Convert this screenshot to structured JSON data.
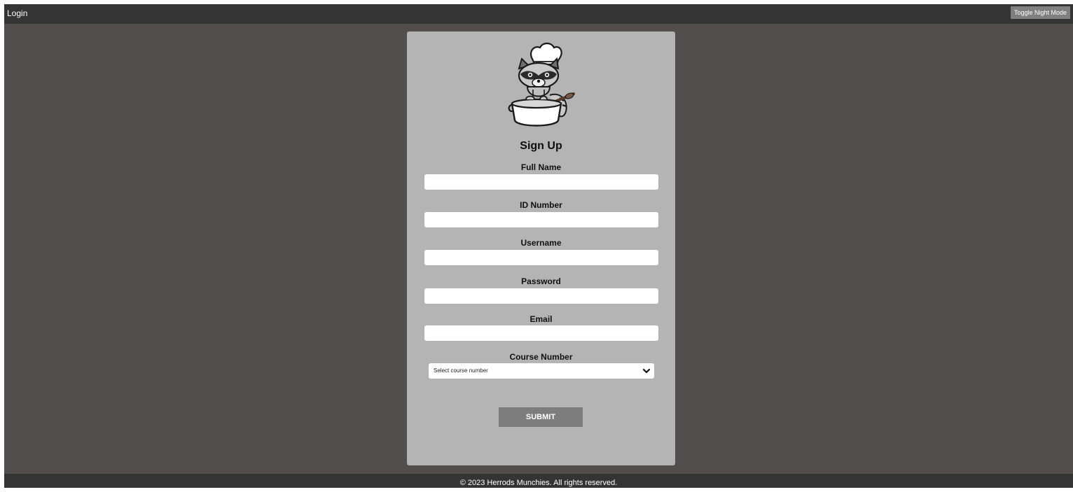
{
  "nav": {
    "login_label": "Login",
    "night_mode_label": "Toggle Night Mode"
  },
  "form": {
    "title": "Sign Up",
    "fields": [
      {
        "label": "Full Name",
        "value": ""
      },
      {
        "label": "ID Number",
        "value": ""
      },
      {
        "label": "Username",
        "value": ""
      },
      {
        "label": "Password",
        "value": ""
      },
      {
        "label": "Email",
        "value": ""
      }
    ],
    "course": {
      "label": "Course Number",
      "selected": "Select course number"
    },
    "submit_label": "SUBMIT"
  },
  "footer": {
    "text": "© 2023 Herrods Munchies. All rights reserved."
  },
  "colors": {
    "page_bg": "#524e4d",
    "bar_bg": "#343434",
    "card_bg": "#b4b4b4",
    "button_bg": "#7d7d7d"
  }
}
